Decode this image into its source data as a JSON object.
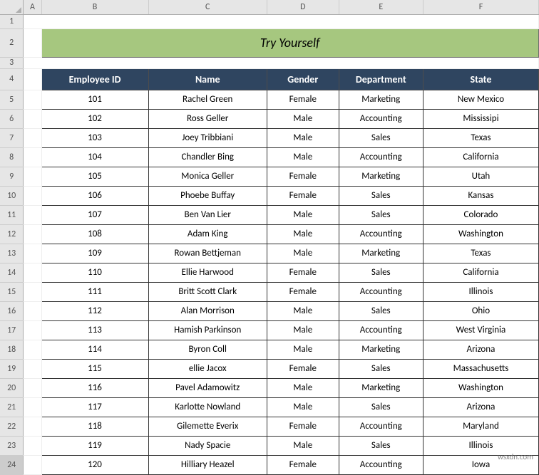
{
  "columns": [
    "A",
    "B",
    "C",
    "D",
    "E",
    "F"
  ],
  "title": "Try Yourself",
  "headers": {
    "emp_id": "Employee ID",
    "name": "Name",
    "gender": "Gender",
    "dept": "Department",
    "state": "State"
  },
  "rows": [
    {
      "id": "101",
      "name": "Rachel Green",
      "gender": "Female",
      "dept": "Marketing",
      "state": "New Mexico"
    },
    {
      "id": "102",
      "name": "Ross Geller",
      "gender": "Male",
      "dept": "Accounting",
      "state": "Mississipi"
    },
    {
      "id": "103",
      "name": "Joey Tribbiani",
      "gender": "Male",
      "dept": "Sales",
      "state": "Texas"
    },
    {
      "id": "104",
      "name": "Chandler Bing",
      "gender": "Male",
      "dept": "Accounting",
      "state": "California"
    },
    {
      "id": "105",
      "name": "Monica Geller",
      "gender": "Female",
      "dept": "Marketing",
      "state": "Utah"
    },
    {
      "id": "106",
      "name": "Phoebe Buffay",
      "gender": "Female",
      "dept": "Sales",
      "state": "Kansas"
    },
    {
      "id": "107",
      "name": "Ben Van Lier",
      "gender": "Male",
      "dept": "Sales",
      "state": "Colorado"
    },
    {
      "id": "108",
      "name": "Adam King",
      "gender": "Male",
      "dept": "Accounting",
      "state": "Washington"
    },
    {
      "id": "109",
      "name": "Rowan Bettjeman",
      "gender": "Male",
      "dept": "Marketing",
      "state": "Texas"
    },
    {
      "id": "110",
      "name": "Ellie Harwood",
      "gender": "Female",
      "dept": "Sales",
      "state": "California"
    },
    {
      "id": "111",
      "name": "Britt Scott Clark",
      "gender": "Female",
      "dept": "Accounting",
      "state": "Illinois"
    },
    {
      "id": "112",
      "name": "Alan Morrison",
      "gender": "Male",
      "dept": "Sales",
      "state": "Ohio"
    },
    {
      "id": "113",
      "name": "Hamish Parkinson",
      "gender": "Male",
      "dept": "Accounting",
      "state": "West Virginia"
    },
    {
      "id": "114",
      "name": "Byron Coll",
      "gender": "Male",
      "dept": "Marketing",
      "state": "Arizona"
    },
    {
      "id": "115",
      "name": "ellie Jacox",
      "gender": "Female",
      "dept": "Sales",
      "state": "Massachusetts"
    },
    {
      "id": "116",
      "name": "Pavel Adamowitz",
      "gender": "Male",
      "dept": "Marketing",
      "state": "Washington"
    },
    {
      "id": "117",
      "name": "Karlotte Nowland",
      "gender": "Male",
      "dept": "Sales",
      "state": "Arizona"
    },
    {
      "id": "118",
      "name": "Gilemette Everix",
      "gender": "Female",
      "dept": "Accounting",
      "state": "Maryland"
    },
    {
      "id": "119",
      "name": "Nady Spacie",
      "gender": "Male",
      "dept": "Sales",
      "state": "Illinois"
    },
    {
      "id": "120",
      "name": "Hilliary Heazel",
      "gender": "Female",
      "dept": "Accounting",
      "state": "Iowa"
    }
  ],
  "watermark": "wsxdn.com",
  "row_numbers": [
    "1",
    "2",
    "3",
    "4",
    "5",
    "6",
    "7",
    "8",
    "9",
    "10",
    "11",
    "12",
    "13",
    "14",
    "15",
    "16",
    "17",
    "18",
    "19",
    "20",
    "21",
    "22",
    "23",
    "24"
  ]
}
